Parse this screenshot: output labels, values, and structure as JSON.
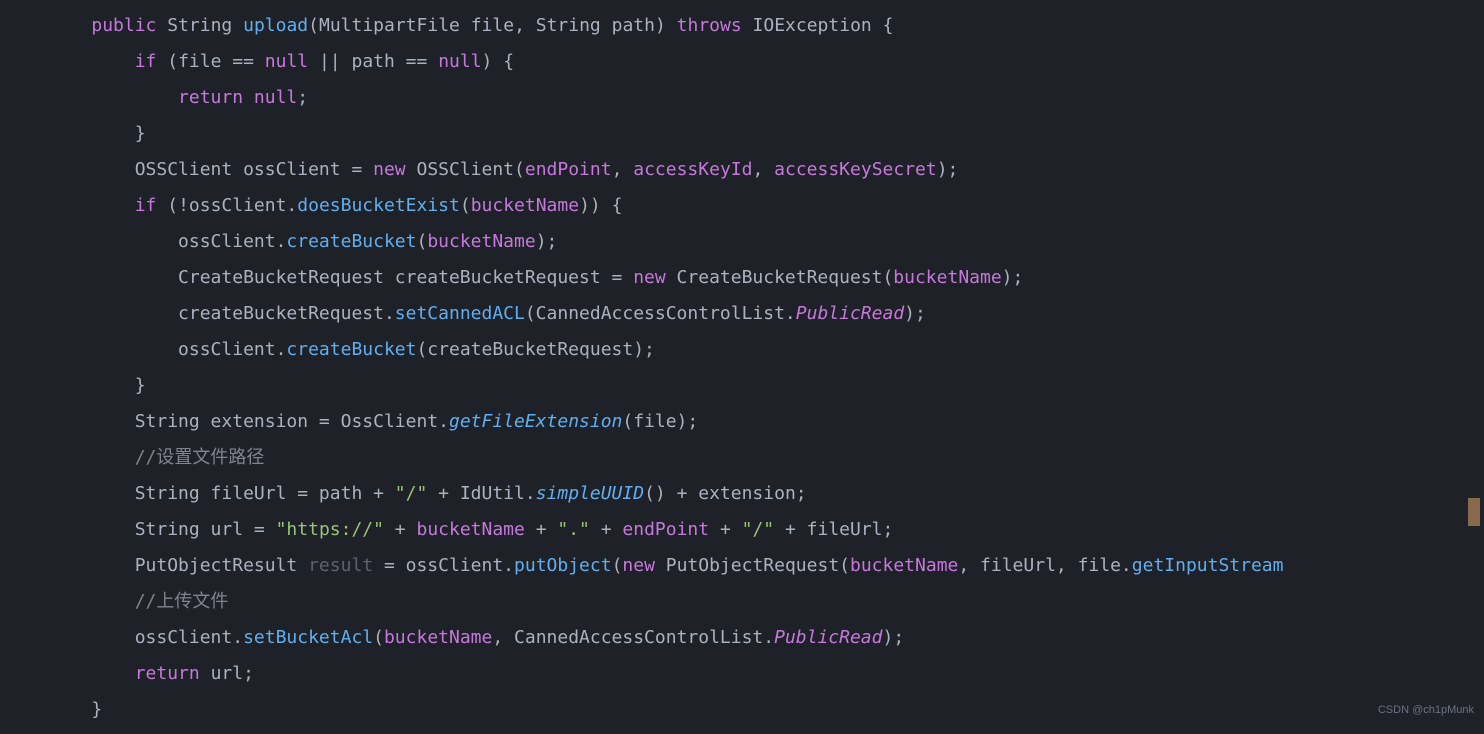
{
  "watermark": "CSDN @ch1pMunk",
  "code": {
    "l1": {
      "kw_public": "public",
      "type_string": "String",
      "fn_upload": "upload",
      "paren_open": "(",
      "type_mpf": "MultipartFile file",
      "comma1": ", ",
      "type_string2": "String path",
      "paren_close": ")",
      "kw_throws": "throws",
      "type_ioe": "IOException",
      "brace_open": "{"
    },
    "l2": {
      "kw_if": "if",
      "cond": " (file == ",
      "kw_null1": "null",
      "op_or": " || ",
      "var_path": "path == ",
      "kw_null2": "null",
      "close": ") {"
    },
    "l3": {
      "kw_return": "return",
      "sp": " ",
      "kw_null": "null",
      "semi": ";"
    },
    "l4": {
      "brace": "}"
    },
    "l5": {
      "type": "OSSClient ossClient = ",
      "kw_new": "new",
      "cls": " OSSClient(",
      "f1": "endPoint",
      "c1": ", ",
      "f2": "accessKeyId",
      "c2": ", ",
      "f3": "accessKeySecret",
      "close": ");"
    },
    "l6": {
      "kw_if": "if",
      "open": " (!ossClient.",
      "fn": "doesBucketExist",
      "p1": "(",
      "f1": "bucketName",
      "close": ")) {"
    },
    "l7": {
      "obj": "ossClient.",
      "fn": "createBucket",
      "p1": "(",
      "f1": "bucketName",
      "close": ");"
    },
    "l8": {
      "decl": "CreateBucketRequest createBucketRequest = ",
      "kw_new": "new",
      "cls": " CreateBucketRequest(",
      "f1": "bucketName",
      "close": ");"
    },
    "l9": {
      "obj": "createBucketRequest.",
      "fn": "setCannedACL",
      "open": "(CannedAccessControlList.",
      "val": "PublicRead",
      "close": ");"
    },
    "l10": {
      "obj": "ossClient.",
      "fn": "createBucket",
      "args": "(createBucketRequest);"
    },
    "l11": {
      "brace": "}"
    },
    "l12": {
      "decl": "String extension = OssClient.",
      "fn": "getFileExtension",
      "args": "(file);"
    },
    "l13": {
      "comment": "//设置文件路径"
    },
    "l14": {
      "decl": "String fileUrl = path + ",
      "s1": "\"/\"",
      "op1": " + IdUtil.",
      "fn": "simpleUUID",
      "args": "() + extension;"
    },
    "l15": {
      "decl": "String url = ",
      "s1": "\"https://\"",
      "op1": " + ",
      "f1": "bucketName",
      "op2": " + ",
      "s2": "\".\"",
      "op3": " + ",
      "f2": "endPoint",
      "op4": " + ",
      "s3": "\"/\"",
      "op5": " + fileUrl;"
    },
    "l16": {
      "decl": "PutObjectResult ",
      "var": "result",
      "eq": " = ossClient.",
      "fn": "putObject",
      "open": "(",
      "kw_new": "new",
      "cls": " PutObjectRequest(",
      "f1": "bucketName",
      "c1": ", fileUrl, file.",
      "fn2": "getInputStream"
    },
    "l17": {
      "comment": "//上传文件"
    },
    "l18": {
      "obj": "ossClient.",
      "fn": "setBucketAcl",
      "open": "(",
      "f1": "bucketName",
      "c1": ", CannedAccessControlList.",
      "val": "PublicRead",
      "close": ");"
    },
    "l19": {
      "kw_return": "return",
      "args": " url;"
    },
    "l20": {
      "brace": "}"
    }
  }
}
